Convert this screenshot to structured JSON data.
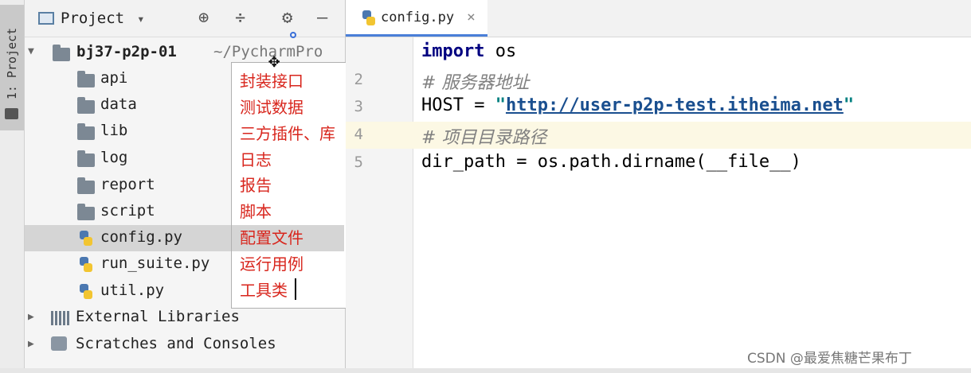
{
  "tool_window": {
    "tab_label": "1: Project"
  },
  "panel": {
    "title": "Project",
    "dropdown_glyph": "▾",
    "actions": [
      {
        "name": "locate-icon",
        "glyph": "⊕"
      },
      {
        "name": "collapse-icon",
        "glyph": "÷"
      },
      {
        "name": "gear-icon",
        "glyph": "⚙"
      },
      {
        "name": "minimize-icon",
        "glyph": "—"
      }
    ]
  },
  "tree": {
    "root": {
      "name": "bj37-p2p-01",
      "path": "~/PycharmPro"
    },
    "items": [
      {
        "label": "api",
        "kind": "folder"
      },
      {
        "label": "data",
        "kind": "folder"
      },
      {
        "label": "lib",
        "kind": "folder"
      },
      {
        "label": "log",
        "kind": "folder"
      },
      {
        "label": "report",
        "kind": "folder"
      },
      {
        "label": "script",
        "kind": "folder"
      },
      {
        "label": "config.py",
        "kind": "python",
        "selected": true
      },
      {
        "label": "run_suite.py",
        "kind": "python"
      },
      {
        "label": "util.py",
        "kind": "python"
      }
    ],
    "external_libraries": "External Libraries",
    "scratches": "Scratches and Consoles"
  },
  "annotations": [
    "封装接口",
    "测试数据",
    "三方插件、库",
    "日志",
    "报告",
    "脚本",
    "配置文件",
    "运行用例",
    "工具类"
  ],
  "editor": {
    "tab": {
      "label": "config.py",
      "close_glyph": "×"
    },
    "line_numbers": [
      "2",
      "3",
      "4",
      "5"
    ],
    "code": {
      "l1_kw": "import",
      "l1_rest": " os",
      "l2": "# 服务器地址",
      "l3_pre": "HOST = ",
      "l3_q1": "\"",
      "l3_url": "http://user-p2p-test.itheima.net",
      "l3_q2": "\"",
      "l4": "# 项目目录路径",
      "l5": "dir_path = os.path.dirname(__file__)"
    }
  },
  "watermark": "CSDN @最爱焦糖芒果布丁",
  "colors": {
    "annotation_red": "#d8261d",
    "keyword_blue": "#000080",
    "string_teal": "#008080",
    "selection_gray": "#d5d5d5",
    "line_highlight": "#fcf8e4"
  }
}
